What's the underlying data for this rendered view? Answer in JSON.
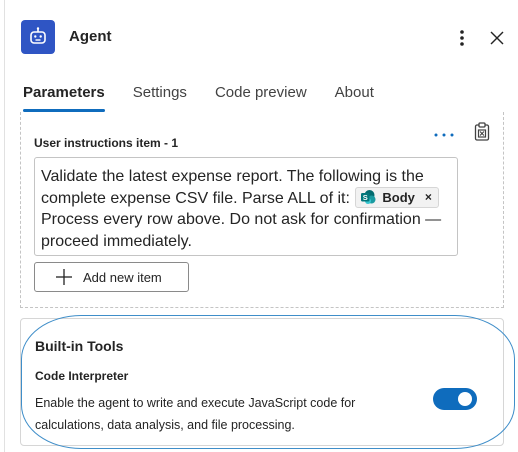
{
  "header": {
    "title": "Agent",
    "icon": "agent-robot-icon",
    "icon_bg": "#2f55c4"
  },
  "tabs": [
    {
      "label": "Parameters",
      "active": true
    },
    {
      "label": "Settings",
      "active": false
    },
    {
      "label": "Code preview",
      "active": false
    },
    {
      "label": "About",
      "active": false
    }
  ],
  "instructions": {
    "item_label": "User instructions item - 1",
    "text_before": "Validate the latest expense report.  The following is the complete expense CSV file. Parse ALL of it: ",
    "token_label": "Body",
    "token_remove": "×",
    "text_after": " Process every row above. Do not ask for confirmation — proceed immediately.",
    "add_button_label": "Add new item"
  },
  "tools": {
    "title": "Built-in Tools",
    "code_interpreter": {
      "title": "Code Interpreter",
      "description": "Enable the agent to write and execute JavaScript code for calculations, data analysis, and file processing.",
      "enabled": true
    }
  },
  "colors": {
    "accent": "#0f6cbd",
    "highlight": "#3f8ec9"
  }
}
